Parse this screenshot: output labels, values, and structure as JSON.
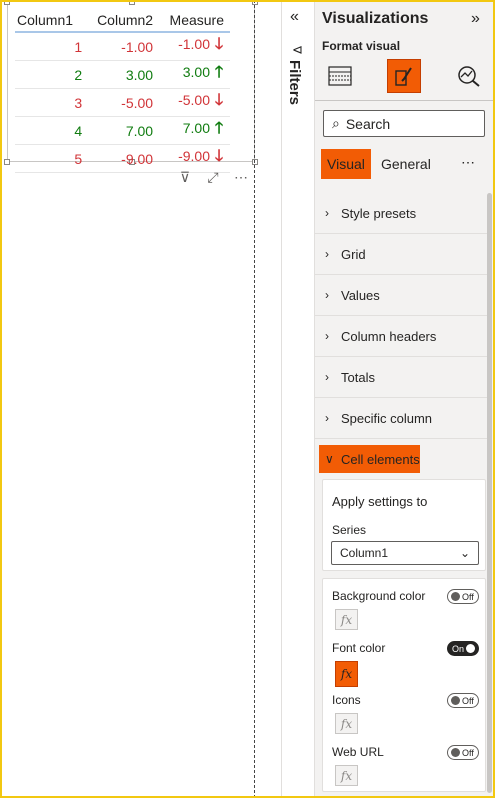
{
  "table": {
    "headers": [
      "Column1",
      "Column2",
      "Measure"
    ],
    "rows": [
      {
        "c1": "1",
        "c2": "-1.00",
        "m": "-1.00",
        "dir": "down"
      },
      {
        "c1": "2",
        "c2": "3.00",
        "m": "3.00",
        "dir": "up"
      },
      {
        "c1": "3",
        "c2": "-5.00",
        "m": "-5.00",
        "dir": "down"
      },
      {
        "c1": "4",
        "c2": "7.00",
        "m": "7.00",
        "dir": "up"
      },
      {
        "c1": "5",
        "c2": "-9.00",
        "m": "-9.00",
        "dir": "down"
      }
    ],
    "colors": {
      "negative": "#d13438",
      "positive": "#107c10"
    }
  },
  "visual_icons": {
    "filter": "filter-icon",
    "focus": "focus-mode-icon",
    "more": "more-options-icon"
  },
  "filters_pane": {
    "label": "Filters",
    "collapse_glyph": "«",
    "funnel_glyph": "⊲"
  },
  "viz_pane": {
    "title": "Visualizations",
    "expand_glyph": "»",
    "subtitle": "Format visual",
    "search_placeholder": "Search",
    "search_icon": "⌕",
    "tabs": [
      {
        "label": "Visual",
        "active": true
      },
      {
        "label": "General",
        "active": false
      }
    ],
    "more_glyph": "⋯",
    "sections": [
      {
        "label": "Style presets"
      },
      {
        "label": "Grid"
      },
      {
        "label": "Values"
      },
      {
        "label": "Column headers"
      },
      {
        "label": "Totals"
      },
      {
        "label": "Specific column"
      }
    ],
    "open_section": {
      "label": "Cell elements"
    },
    "apply": {
      "heading": "Apply settings to",
      "series_label": "Series",
      "series_value": "Column1"
    },
    "toggles": [
      {
        "label": "Background color",
        "state": "Off"
      },
      {
        "label": "Font color",
        "state": "On"
      },
      {
        "label": "Icons",
        "state": "Off"
      },
      {
        "label": "Web URL",
        "state": "Off"
      }
    ],
    "fx_label": "fx",
    "accent": "#f25c05"
  }
}
